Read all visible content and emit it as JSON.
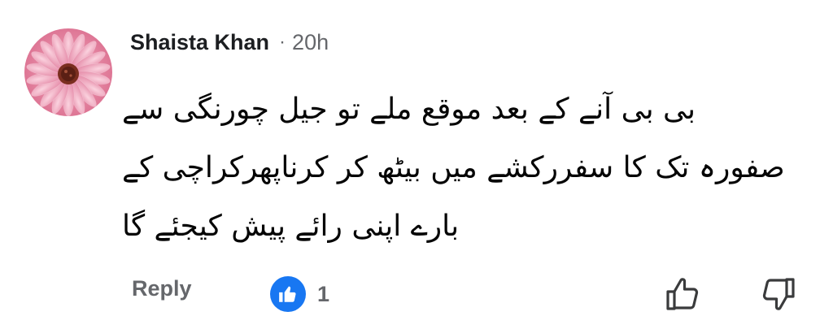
{
  "comment": {
    "author": "Shaista Khan",
    "separator": "·",
    "time": "20h",
    "lines": [
      "بی بی آنے کے بعد موقع ملے تو جیل چورنگی سے",
      "صفورہ تک کا سفررکشے میں بیٹھ کر کرناپھرکراچی کے",
      "بارے اپنی رائے پیش کیجئے گا"
    ]
  },
  "actions": {
    "reply_label": "Reply",
    "reaction_count": "1",
    "reaction_icon": "like-icon",
    "upvote_icon": "thumbs-up-icon",
    "downvote_icon": "thumbs-down-icon"
  },
  "colors": {
    "author_text": "#1c1e21",
    "muted_text": "#65676b",
    "like_blue": "#1877f2",
    "avatar_flower": "#e58aa8"
  }
}
